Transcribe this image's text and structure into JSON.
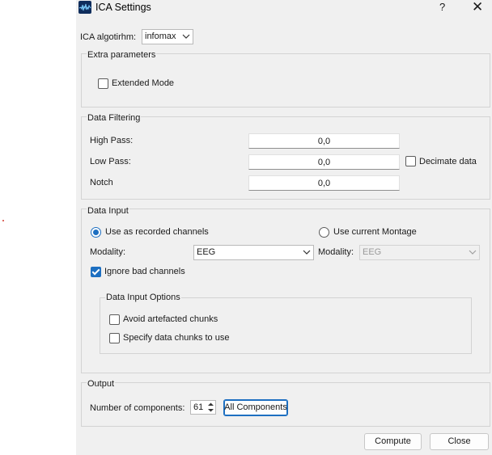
{
  "window": {
    "title": "ICA Settings",
    "help_label": "?",
    "close_label": "✕"
  },
  "algorithm": {
    "label": "ICA algotirhm:",
    "value": "infomax"
  },
  "extra_parameters": {
    "title": "Extra parameters",
    "extended_mode": {
      "label": "Extended Mode",
      "checked": false
    }
  },
  "data_filtering": {
    "title": "Data Filtering",
    "high_pass": {
      "label": "High Pass:",
      "value": "0,0"
    },
    "low_pass": {
      "label": "Low Pass:",
      "value": "0,0"
    },
    "notch": {
      "label": "Notch",
      "value": "0,0"
    },
    "decimate": {
      "label": "Decimate data",
      "checked": false
    }
  },
  "data_input": {
    "title": "Data Input",
    "use_recorded": {
      "label": "Use as recorded channels",
      "selected": true
    },
    "use_montage": {
      "label": "Use current Montage",
      "selected": false
    },
    "modality_label": "Modality:",
    "modality_value": "EEG",
    "montage_modality_label": "Modality:",
    "montage_modality_value": "EEG",
    "ignore_bad": {
      "label": "Ignore bad channels",
      "checked": true
    },
    "options": {
      "title": "Data Input Options",
      "avoid_artefacted": {
        "label": "Avoid artefacted chunks",
        "checked": false
      },
      "specify_chunks": {
        "label": "Specify data chunks to use",
        "checked": false
      }
    }
  },
  "output": {
    "title": "Output",
    "components_label": "Number of components:",
    "components_value": "61",
    "all_components_label": "All Components"
  },
  "footer": {
    "compute_label": "Compute",
    "close_label": "Close"
  },
  "colors": {
    "accent": "#1d6fc1",
    "dialog_bg": "#f0f0f0",
    "stray_dot": "#d23b2f"
  }
}
